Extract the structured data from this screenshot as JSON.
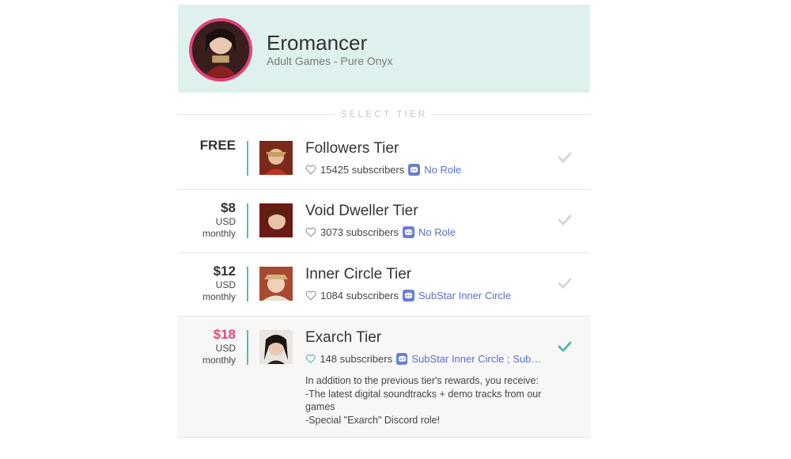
{
  "creator": {
    "name": "Eromancer",
    "subtitle": "Adult Games - Pure Onyx"
  },
  "select_tier_label": "SELECT TIER",
  "tiers": [
    {
      "price": "FREE",
      "currency": "",
      "period": "",
      "name": "Followers Tier",
      "subscribers": "15425 subscribers",
      "role": "No Role",
      "selected": false
    },
    {
      "price": "$8",
      "currency": "USD",
      "period": "monthly",
      "name": "Void Dweller Tier",
      "subscribers": "3073 subscribers",
      "role": "No Role",
      "selected": false
    },
    {
      "price": "$12",
      "currency": "USD",
      "period": "monthly",
      "name": "Inner Circle Tier",
      "subscribers": "1084 subscribers",
      "role": "SubStar Inner Circle",
      "selected": false
    },
    {
      "price": "$18",
      "currency": "USD",
      "period": "monthly",
      "name": "Exarch Tier",
      "subscribers": "148 subscribers",
      "role": "SubStar Inner Circle ; SubSt...",
      "selected": true,
      "description": [
        "In addition to the previous tier's rewards, you receive:",
        "-The latest digital soundtracks + demo tracks from our games",
        "-Special \"Exarch\" Discord role!"
      ]
    }
  ],
  "colors": {
    "header_bg": "#dff1ee",
    "accent_teal": "#5ab9aa",
    "accent_pink": "#e2457d",
    "discord": "#6b7fd1",
    "check_inactive": "#d6d6d6",
    "check_active": "#5ab9aa"
  },
  "icons": {
    "heart": "heart-outline-icon",
    "discord": "discord-icon",
    "check": "check-icon"
  }
}
